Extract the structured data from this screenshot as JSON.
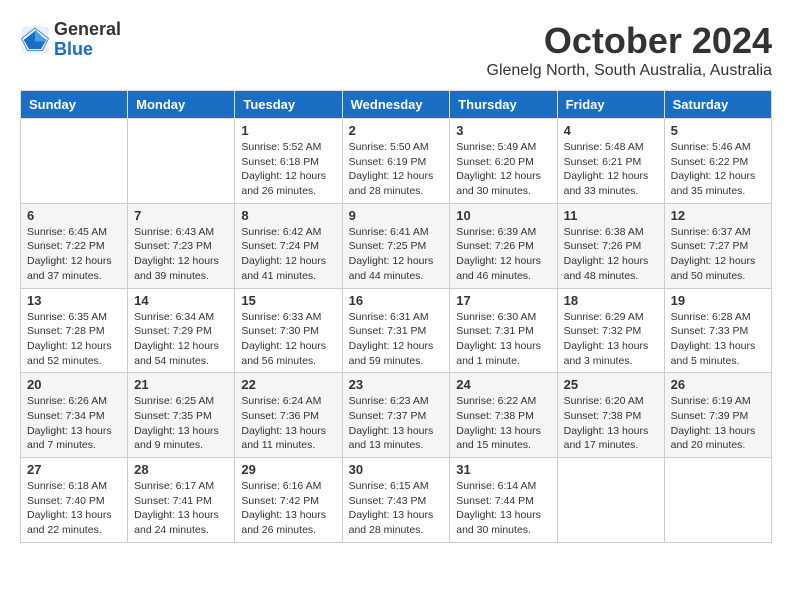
{
  "logo": {
    "line1": "General",
    "line2": "Blue"
  },
  "title": "October 2024",
  "location": "Glenelg North, South Australia, Australia",
  "weekdays": [
    "Sunday",
    "Monday",
    "Tuesday",
    "Wednesday",
    "Thursday",
    "Friday",
    "Saturday"
  ],
  "weeks": [
    [
      {
        "day": "",
        "detail": ""
      },
      {
        "day": "",
        "detail": ""
      },
      {
        "day": "1",
        "detail": "Sunrise: 5:52 AM\nSunset: 6:18 PM\nDaylight: 12 hours\nand 26 minutes."
      },
      {
        "day": "2",
        "detail": "Sunrise: 5:50 AM\nSunset: 6:19 PM\nDaylight: 12 hours\nand 28 minutes."
      },
      {
        "day": "3",
        "detail": "Sunrise: 5:49 AM\nSunset: 6:20 PM\nDaylight: 12 hours\nand 30 minutes."
      },
      {
        "day": "4",
        "detail": "Sunrise: 5:48 AM\nSunset: 6:21 PM\nDaylight: 12 hours\nand 33 minutes."
      },
      {
        "day": "5",
        "detail": "Sunrise: 5:46 AM\nSunset: 6:22 PM\nDaylight: 12 hours\nand 35 minutes."
      }
    ],
    [
      {
        "day": "6",
        "detail": "Sunrise: 6:45 AM\nSunset: 7:22 PM\nDaylight: 12 hours\nand 37 minutes."
      },
      {
        "day": "7",
        "detail": "Sunrise: 6:43 AM\nSunset: 7:23 PM\nDaylight: 12 hours\nand 39 minutes."
      },
      {
        "day": "8",
        "detail": "Sunrise: 6:42 AM\nSunset: 7:24 PM\nDaylight: 12 hours\nand 41 minutes."
      },
      {
        "day": "9",
        "detail": "Sunrise: 6:41 AM\nSunset: 7:25 PM\nDaylight: 12 hours\nand 44 minutes."
      },
      {
        "day": "10",
        "detail": "Sunrise: 6:39 AM\nSunset: 7:26 PM\nDaylight: 12 hours\nand 46 minutes."
      },
      {
        "day": "11",
        "detail": "Sunrise: 6:38 AM\nSunset: 7:26 PM\nDaylight: 12 hours\nand 48 minutes."
      },
      {
        "day": "12",
        "detail": "Sunrise: 6:37 AM\nSunset: 7:27 PM\nDaylight: 12 hours\nand 50 minutes."
      }
    ],
    [
      {
        "day": "13",
        "detail": "Sunrise: 6:35 AM\nSunset: 7:28 PM\nDaylight: 12 hours\nand 52 minutes."
      },
      {
        "day": "14",
        "detail": "Sunrise: 6:34 AM\nSunset: 7:29 PM\nDaylight: 12 hours\nand 54 minutes."
      },
      {
        "day": "15",
        "detail": "Sunrise: 6:33 AM\nSunset: 7:30 PM\nDaylight: 12 hours\nand 56 minutes."
      },
      {
        "day": "16",
        "detail": "Sunrise: 6:31 AM\nSunset: 7:31 PM\nDaylight: 12 hours\nand 59 minutes."
      },
      {
        "day": "17",
        "detail": "Sunrise: 6:30 AM\nSunset: 7:31 PM\nDaylight: 13 hours\nand 1 minute."
      },
      {
        "day": "18",
        "detail": "Sunrise: 6:29 AM\nSunset: 7:32 PM\nDaylight: 13 hours\nand 3 minutes."
      },
      {
        "day": "19",
        "detail": "Sunrise: 6:28 AM\nSunset: 7:33 PM\nDaylight: 13 hours\nand 5 minutes."
      }
    ],
    [
      {
        "day": "20",
        "detail": "Sunrise: 6:26 AM\nSunset: 7:34 PM\nDaylight: 13 hours\nand 7 minutes."
      },
      {
        "day": "21",
        "detail": "Sunrise: 6:25 AM\nSunset: 7:35 PM\nDaylight: 13 hours\nand 9 minutes."
      },
      {
        "day": "22",
        "detail": "Sunrise: 6:24 AM\nSunset: 7:36 PM\nDaylight: 13 hours\nand 11 minutes."
      },
      {
        "day": "23",
        "detail": "Sunrise: 6:23 AM\nSunset: 7:37 PM\nDaylight: 13 hours\nand 13 minutes."
      },
      {
        "day": "24",
        "detail": "Sunrise: 6:22 AM\nSunset: 7:38 PM\nDaylight: 13 hours\nand 15 minutes."
      },
      {
        "day": "25",
        "detail": "Sunrise: 6:20 AM\nSunset: 7:38 PM\nDaylight: 13 hours\nand 17 minutes."
      },
      {
        "day": "26",
        "detail": "Sunrise: 6:19 AM\nSunset: 7:39 PM\nDaylight: 13 hours\nand 20 minutes."
      }
    ],
    [
      {
        "day": "27",
        "detail": "Sunrise: 6:18 AM\nSunset: 7:40 PM\nDaylight: 13 hours\nand 22 minutes."
      },
      {
        "day": "28",
        "detail": "Sunrise: 6:17 AM\nSunset: 7:41 PM\nDaylight: 13 hours\nand 24 minutes."
      },
      {
        "day": "29",
        "detail": "Sunrise: 6:16 AM\nSunset: 7:42 PM\nDaylight: 13 hours\nand 26 minutes."
      },
      {
        "day": "30",
        "detail": "Sunrise: 6:15 AM\nSunset: 7:43 PM\nDaylight: 13 hours\nand 28 minutes."
      },
      {
        "day": "31",
        "detail": "Sunrise: 6:14 AM\nSunset: 7:44 PM\nDaylight: 13 hours\nand 30 minutes."
      },
      {
        "day": "",
        "detail": ""
      },
      {
        "day": "",
        "detail": ""
      }
    ]
  ]
}
